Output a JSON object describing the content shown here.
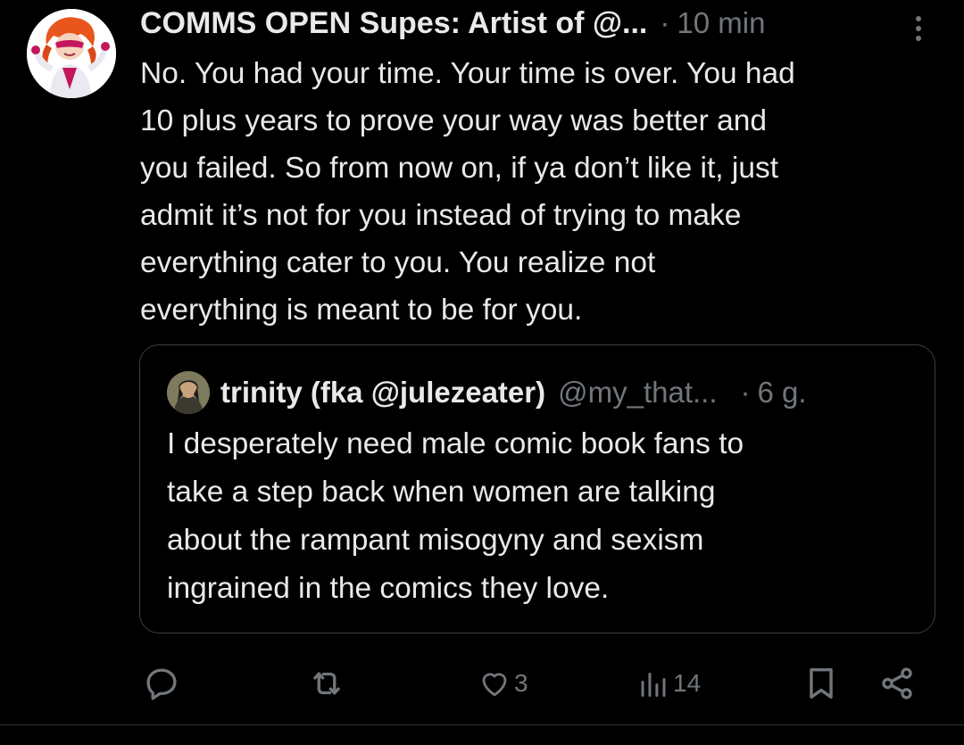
{
  "tweet": {
    "display_name": "COMMS OPEN Supes: Artist of @...",
    "separator": "·",
    "time": "10 min",
    "text_lines": [
      "No. You had your time. Your time is over. You had",
      "10 plus years to prove your way was better and",
      "you failed. So from now on, if ya don’t like it, just",
      "admit it’s not for you instead of trying to make",
      "everything cater to you. You realize not",
      "everything is meant to be for you."
    ]
  },
  "quote": {
    "display_name": "trinity (fka @julezeater)",
    "handle": "@my_that...",
    "separator": "·",
    "time": "6 g.",
    "text_lines": [
      "I desperately need male comic book fans to",
      "take a step back when women are talking",
      "about the rampant misogyny and sexism",
      "ingrained in the comics they love."
    ]
  },
  "actions": {
    "reply": {
      "icon": "reply-icon",
      "count": ""
    },
    "repost": {
      "icon": "repost-icon",
      "count": ""
    },
    "like": {
      "icon": "heart-icon",
      "count": "3"
    },
    "views": {
      "icon": "views-icon",
      "count": "14"
    },
    "bookmark": {
      "icon": "bookmark-icon"
    },
    "share": {
      "icon": "share-icon"
    }
  },
  "colors": {
    "background": "#000000",
    "text": "#e7e9ea",
    "muted": "#71767b",
    "border": "#3a3d41"
  }
}
